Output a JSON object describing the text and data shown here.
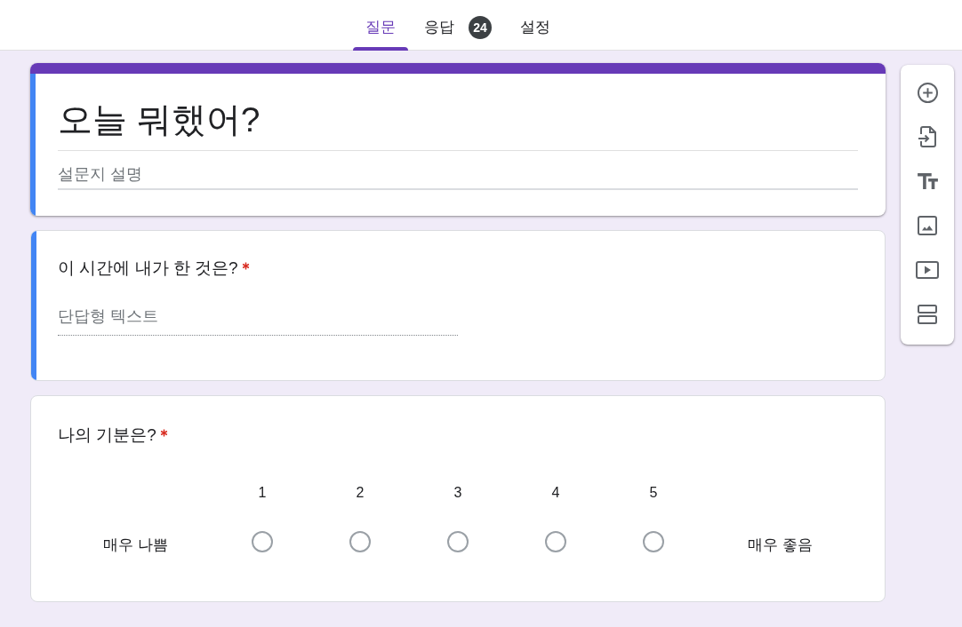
{
  "tabs": [
    {
      "label": "질문",
      "selected": true
    },
    {
      "label": "응답",
      "selected": false,
      "badge": "24"
    },
    {
      "label": "설정",
      "selected": false
    }
  ],
  "header": {
    "title": "오늘 뭐했어?",
    "description": {
      "placeholder": "설문지 설명"
    },
    "selected": true
  },
  "questions": [
    {
      "kind": "short_answer",
      "title": "이 시간에 내가 한 것은?",
      "required": true,
      "selected": true,
      "placeholder": "단답형 텍스트"
    },
    {
      "kind": "linear_scale",
      "title": "나의 기분은?",
      "required": true,
      "selected": false,
      "low_label": "매우 나쁨",
      "high_label": "매우 좋음",
      "options": [
        {
          "label": "1",
          "selected": false
        },
        {
          "label": "2",
          "selected": false
        },
        {
          "label": "3",
          "selected": false
        },
        {
          "label": "4",
          "selected": false
        },
        {
          "label": "5",
          "selected": false
        }
      ]
    }
  ]
}
